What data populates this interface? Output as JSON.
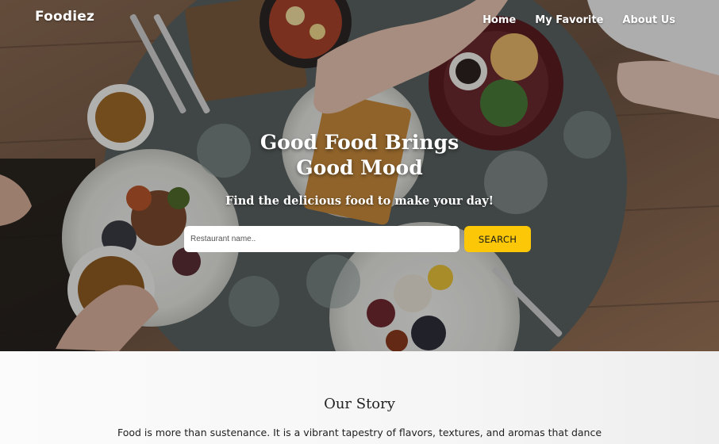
{
  "brand": "Foodiez",
  "nav": {
    "home": "Home",
    "favorite": "My Favorite",
    "about": "About Us"
  },
  "hero": {
    "title_line1": "Good Food Brings",
    "title_line2": "Good Mood",
    "subtitle": "Find the delicious food to make your day!",
    "search": {
      "placeholder": "Restaurant name..",
      "value": "",
      "button": "SEARCH"
    }
  },
  "story": {
    "title": "Our Story",
    "text": "Food is more than sustenance. It is a vibrant tapestry of flavors, textures, and aromas that dance"
  },
  "colors": {
    "accent": "#fcc707",
    "hero_text": "#ffffff"
  }
}
